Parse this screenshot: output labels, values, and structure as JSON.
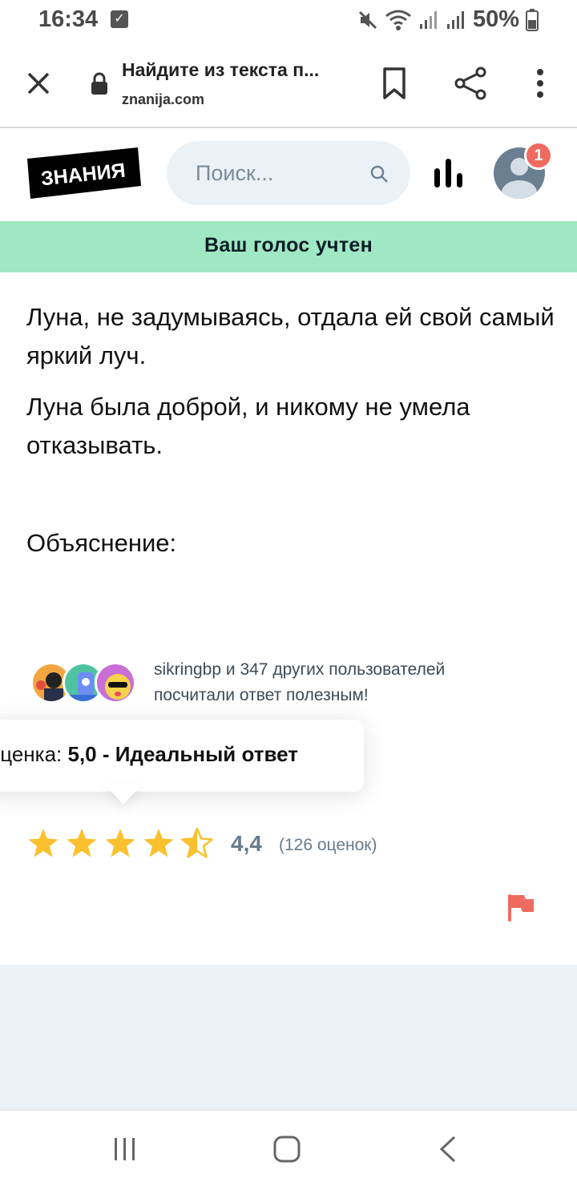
{
  "status_bar": {
    "time": "16:34",
    "battery": "50%",
    "icons": [
      "check-notification-icon",
      "mute-icon",
      "wifi-icon",
      "signal-icon",
      "signal-icon",
      "battery-icon"
    ]
  },
  "browser": {
    "title": "Найдите из текста п...",
    "url": "znanija.com"
  },
  "header": {
    "logo_text": "ЗНАНИЯ",
    "search_placeholder": "Поиск...",
    "notification_count": "1"
  },
  "banner": {
    "text": "Ваш голос учтен"
  },
  "answer": {
    "paragraph1": "Луна, не задумываясь, отдала ей свой самый яркий луч.",
    "paragraph2": "Луна была доброй, и никому не умела отказывать.",
    "explanation_label": "Объяснение:"
  },
  "helpful": {
    "line1": "sikringbp и 347 других пользователей",
    "line2": "посчитали ответ полезным!"
  },
  "tooltip": {
    "prefix": "Оценка: ",
    "bold": "5,0 - Идеальный ответ"
  },
  "rating": {
    "value": "4,4",
    "count": "(126 оценок)",
    "stars_filled": 4.5,
    "star_color": "#fbc02d"
  },
  "colors": {
    "banner": "#9fe8c3",
    "accent_red": "#ef6a5f",
    "search_bg": "#ebf2f7"
  }
}
